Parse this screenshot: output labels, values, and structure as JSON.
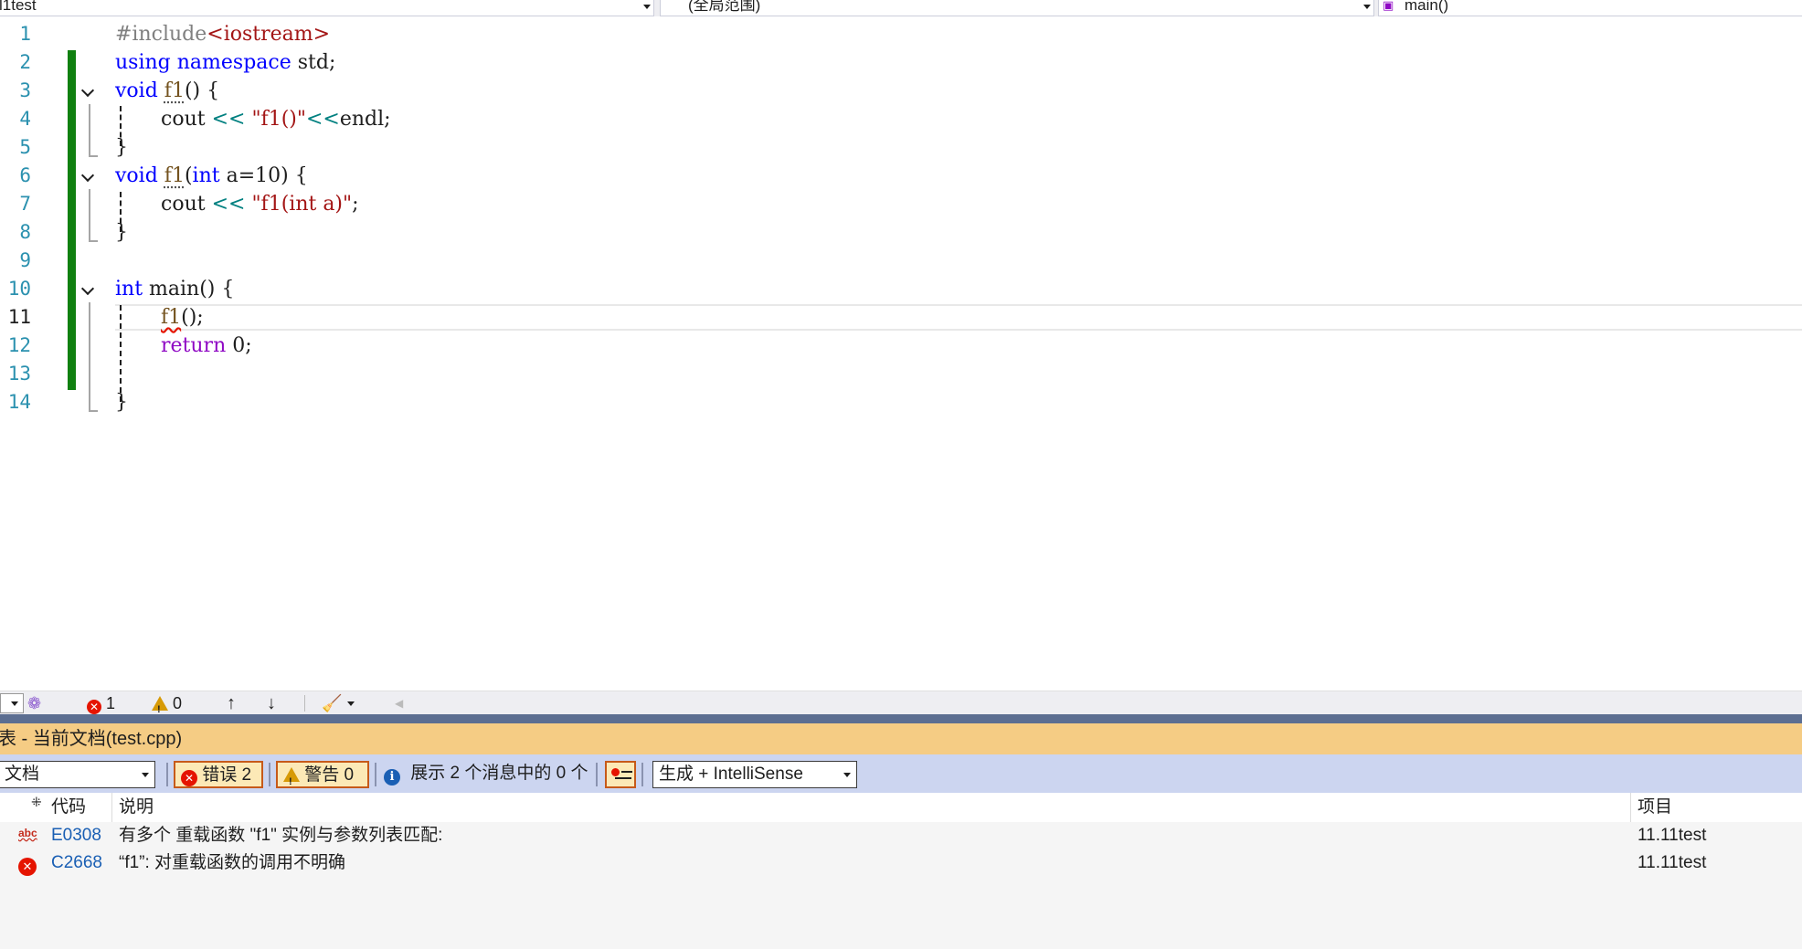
{
  "navbar": {
    "project": "l1test",
    "scope": "(全局范围)",
    "member": "main()"
  },
  "editor": {
    "line_numbers": [
      "1",
      "2",
      "3",
      "4",
      "5",
      "6",
      "7",
      "8",
      "9",
      "10",
      "11",
      "12",
      "13",
      "14"
    ],
    "code": {
      "l1_directive": "#include",
      "l1_header": "<iostream>",
      "l2_using": "using",
      "l2_namespace": "namespace",
      "l2_rest": " std;",
      "l3_void": "void",
      "l3_name": "f1",
      "l3_rest": "() {",
      "l4_cout": "cout",
      "l4_op": " << ",
      "l4_str": "\"f1()\"",
      "l4_op2": "<<",
      "l4_endl": "endl",
      "l4_end": ";",
      "l5": "}",
      "l6_void": "void",
      "l6_name": "f1",
      "l6_paren": "(",
      "l6_int": "int",
      "l6_rest": " a=10) {",
      "l7_cout": "cout",
      "l7_op": " << ",
      "l7_str": "\"f1(int a)\"",
      "l7_end": ";",
      "l8": "}",
      "l10_int": "int",
      "l10_rest": " main() {",
      "l11_call": "f1",
      "l11_rest": "();",
      "l12_return": "return",
      "l12_rest": " 0;",
      "l14": "}"
    }
  },
  "status_strip": {
    "error_count": "1",
    "warning_count": "0"
  },
  "error_list": {
    "title": "表 - 当前文档(test.cpp)",
    "scope_select": "文档",
    "errors_button": "错误 2",
    "warnings_button": "警告 0",
    "messages_text": "展示 2 个消息中的 0 个",
    "source_select": "生成 + IntelliSense",
    "columns": {
      "code": "代码",
      "description": "说明",
      "project": "项目"
    },
    "rows": [
      {
        "code": "E0308",
        "description": "有多个 重载函数 \"f1\" 实例与参数列表匹配:",
        "project": "11.11test",
        "icon": "intellisense-error-icon"
      },
      {
        "code": "C2668",
        "description": "“f1”: 对重载函数的调用不明确",
        "project": "11.11test",
        "icon": "error-icon"
      }
    ]
  },
  "colors": {
    "keyword": "#0000ff",
    "control_keyword": "#8f08c4",
    "string": "#a31515",
    "change_bar": "#108010",
    "error_list_title": "#f5cc84",
    "error_list_toolbar": "#ccd5f0",
    "error": "#e51400"
  }
}
